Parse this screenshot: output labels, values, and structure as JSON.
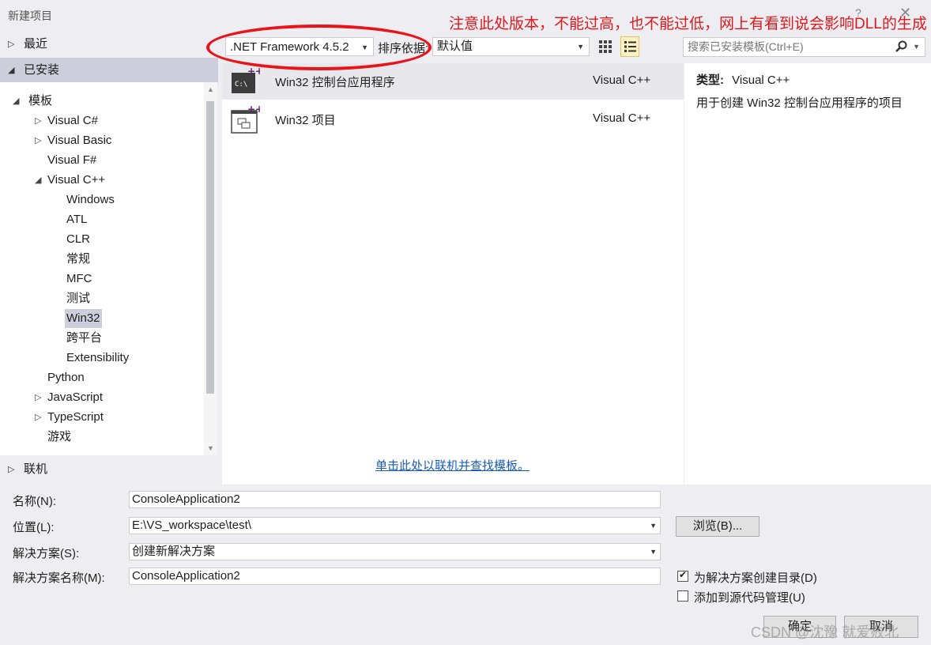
{
  "window": {
    "title": "新建项目",
    "help": "?",
    "close": "✕"
  },
  "left": {
    "recent": "最近",
    "installed": "已安装",
    "online": "联机",
    "tree": [
      {
        "label": "模板",
        "level": 0,
        "twisty": "expanded"
      },
      {
        "label": "Visual C#",
        "level": 1,
        "twisty": "collapsed"
      },
      {
        "label": "Visual Basic",
        "level": 1,
        "twisty": "collapsed"
      },
      {
        "label": "Visual F#",
        "level": 1,
        "twisty": "none"
      },
      {
        "label": "Visual C++",
        "level": 1,
        "twisty": "expanded"
      },
      {
        "label": "Windows",
        "level": 2,
        "twisty": "none"
      },
      {
        "label": "ATL",
        "level": 2,
        "twisty": "none"
      },
      {
        "label": "CLR",
        "level": 2,
        "twisty": "none"
      },
      {
        "label": "常规",
        "level": 2,
        "twisty": "none"
      },
      {
        "label": "MFC",
        "level": 2,
        "twisty": "none"
      },
      {
        "label": "测试",
        "level": 2,
        "twisty": "none"
      },
      {
        "label": "Win32",
        "level": 2,
        "twisty": "none",
        "selected": true
      },
      {
        "label": "跨平台",
        "level": 2,
        "twisty": "none"
      },
      {
        "label": "Extensibility",
        "level": 2,
        "twisty": "none"
      },
      {
        "label": "Python",
        "level": 1,
        "twisty": "none"
      },
      {
        "label": "JavaScript",
        "level": 1,
        "twisty": "collapsed"
      },
      {
        "label": "TypeScript",
        "level": 1,
        "twisty": "collapsed"
      },
      {
        "label": "游戏",
        "level": 1,
        "twisty": "none"
      }
    ]
  },
  "toolbar": {
    "framework": ".NET Framework 4.5.2",
    "sort_label": "排序依据:",
    "sort_value": "默认值",
    "search_placeholder": "搜索已安装模板(Ctrl+E)"
  },
  "annotation": "注意此处版本，不能过高，也不能过低，网上有看到说会影响DLL的生成",
  "templates": [
    {
      "name": "Win32 控制台应用程序",
      "lang": "Visual C++",
      "icon": "console-template-icon",
      "selected": true
    },
    {
      "name": "Win32 项目",
      "lang": "Visual C++",
      "icon": "window-template-icon",
      "selected": false
    }
  ],
  "online_link": "单击此处以联机并查找模板。",
  "details": {
    "type_label": "类型:",
    "type_value": "Visual C++",
    "description": "用于创建 Win32 控制台应用程序的项目"
  },
  "form": {
    "name_label": "名称(N):",
    "name_value": "ConsoleApplication2",
    "location_label": "位置(L):",
    "location_value": "E:\\VS_workspace\\test\\",
    "browse": "浏览(B)...",
    "solution_label": "解决方案(S):",
    "solution_value": "创建新解决方案",
    "solution_name_label": "解决方案名称(M):",
    "solution_name_value": "ConsoleApplication2",
    "create_dir": "为解决方案创建目录(D)",
    "create_dir_checked": true,
    "source_control": "添加到源代码管理(U)",
    "source_control_checked": false,
    "ok": "确定",
    "cancel": "取消"
  },
  "watermark": "CSDN @沈豫    就爱败北",
  "colors": {
    "accent_red": "#e0181b",
    "link_blue": "#1a5bbd",
    "selection": "#cccedb"
  }
}
